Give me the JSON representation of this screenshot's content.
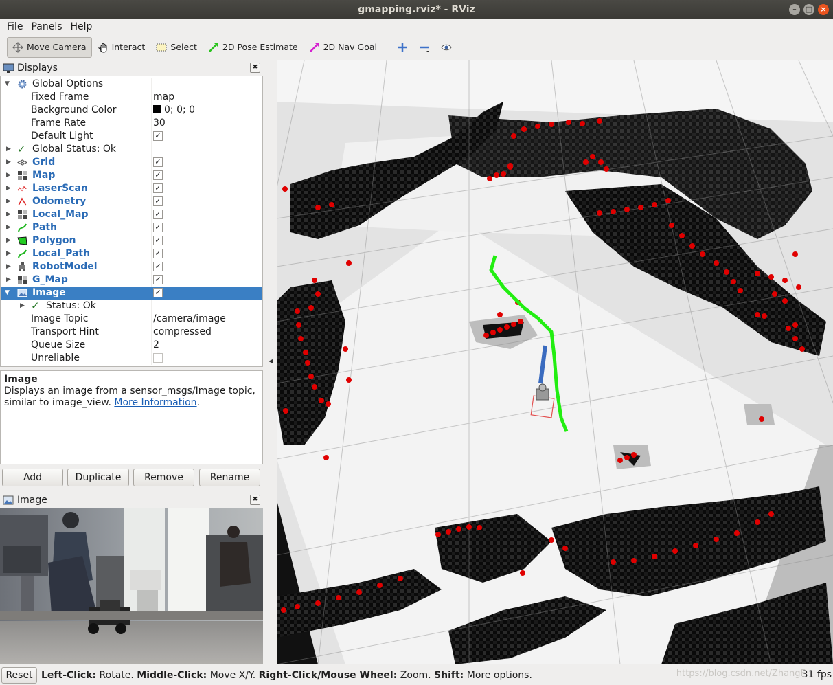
{
  "window": {
    "title": "gmapping.rviz* - RViz"
  },
  "menu": [
    "File",
    "Panels",
    "Help"
  ],
  "toolbar": {
    "move_camera": "Move Camera",
    "interact": "Interact",
    "select": "Select",
    "pose_estimate": "2D Pose Estimate",
    "nav_goal": "2D Nav Goal"
  },
  "displays_panel": {
    "title": "Displays",
    "rows": [
      {
        "label": "Global Options",
        "value": ""
      },
      {
        "label": "Fixed Frame",
        "value": "map"
      },
      {
        "label": "Background Color",
        "value": "0; 0; 0"
      },
      {
        "label": "Frame Rate",
        "value": "30"
      },
      {
        "label": "Default Light",
        "value": ""
      },
      {
        "label": "Global Status: Ok",
        "value": ""
      },
      {
        "label": "Grid",
        "value": ""
      },
      {
        "label": "Map",
        "value": ""
      },
      {
        "label": "LaserScan",
        "value": ""
      },
      {
        "label": "Odometry",
        "value": ""
      },
      {
        "label": "Local_Map",
        "value": ""
      },
      {
        "label": "Path",
        "value": ""
      },
      {
        "label": "Polygon",
        "value": ""
      },
      {
        "label": "Local_Path",
        "value": ""
      },
      {
        "label": "RobotModel",
        "value": ""
      },
      {
        "label": "G_Map",
        "value": ""
      },
      {
        "label": "Image",
        "value": ""
      },
      {
        "label": "Status: Ok",
        "value": ""
      },
      {
        "label": "Image Topic",
        "value": "/camera/image"
      },
      {
        "label": "Transport Hint",
        "value": "compressed"
      },
      {
        "label": "Queue Size",
        "value": "2"
      },
      {
        "label": "Unreliable",
        "value": ""
      }
    ],
    "background_swatch": "#000000"
  },
  "description": {
    "title": "Image",
    "text": "Displays an image from a sensor_msgs/Image topic, similar to image_view.",
    "link": "More Information",
    "tail": "."
  },
  "buttons": {
    "add": "Add",
    "duplicate": "Duplicate",
    "remove": "Remove",
    "rename": "Rename"
  },
  "image_panel": {
    "title": "Image"
  },
  "statusbar": {
    "reset": "Reset",
    "k1": "Left-Click:",
    "v1": "Rotate.",
    "k2": "Middle-Click:",
    "v2": "Move X/Y.",
    "k3": "Right-Click/Mouse Wheel:",
    "v3": "Zoom.",
    "k4": "Shift:",
    "v4": "More options.",
    "fps": "31 fps",
    "watermark": "https://blog.csdn.net/ZhangF"
  },
  "colors": {
    "selection": "#3a7fc4",
    "link": "#1b5fb5",
    "display_name": "#2a6bb6",
    "laser_points": "#e00000",
    "path": "#22ee11",
    "odometry_arrow": "#3a6bbf"
  }
}
